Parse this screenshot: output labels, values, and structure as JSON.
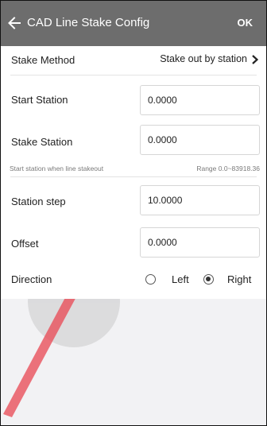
{
  "header": {
    "title": "CAD Line Stake Config",
    "ok_label": "OK",
    "back_icon": "arrow-left-icon"
  },
  "form": {
    "stake_method": {
      "label": "Stake Method",
      "value": "Stake out by station",
      "icon": "chevron-right-icon"
    },
    "start_station": {
      "label": "Start Station",
      "value": "0.0000"
    },
    "stake_station": {
      "label": "Stake Station",
      "value": "0.0000",
      "hint": "Start station when line stakeout",
      "range": "Range 0.0~83918.36"
    },
    "station_step": {
      "label": "Station step",
      "value": "10.0000"
    },
    "offset": {
      "label": "Offset",
      "value": "0.0000"
    },
    "direction": {
      "label": "Direction",
      "options": [
        "Left",
        "Right"
      ],
      "selected": "Right"
    }
  },
  "colors": {
    "header_bg": "#6d6d6d",
    "page_bg": "#f2f2f4",
    "form_bg": "#ffffff",
    "watermark_red": "#e8505b",
    "watermark_gray": "#cfcfcf"
  }
}
